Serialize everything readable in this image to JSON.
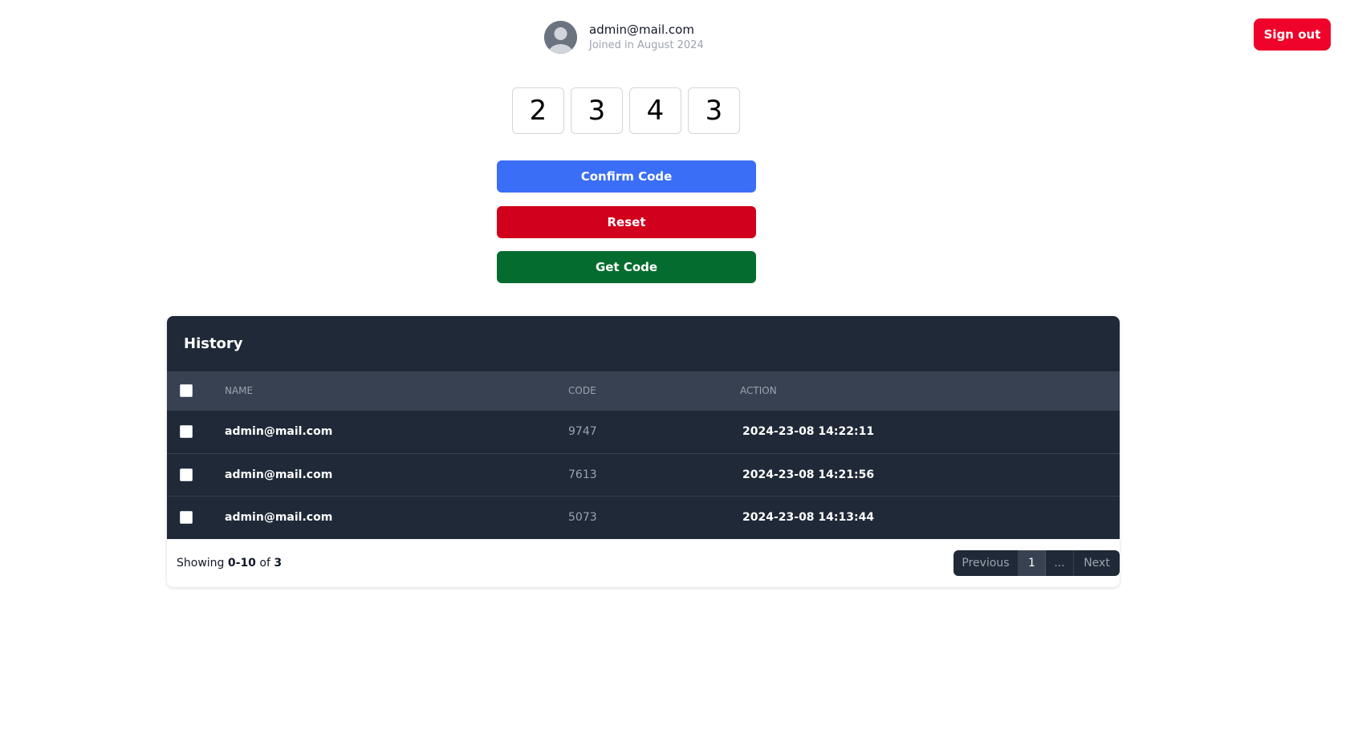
{
  "profile": {
    "email": "admin@mail.com",
    "joined": "Joined in August 2024",
    "avatar_icon": "user-avatar-icon"
  },
  "header": {
    "signout_label": "Sign out",
    "signout_color": "#f0032a"
  },
  "code": {
    "digits": [
      "2",
      "3",
      "4",
      "3"
    ]
  },
  "actions": {
    "confirm_label": "Confirm Code",
    "reset_label": "Reset",
    "get_label": "Get Code",
    "confirm_color": "#3b6ef6",
    "reset_color": "#d1001c",
    "get_color": "#046c2e"
  },
  "history": {
    "title": "History",
    "columns": [
      "NAME",
      "CODE",
      "ACTION"
    ],
    "rows": [
      {
        "name": "admin@mail.com",
        "code": "9747",
        "action": "2024-23-08 14:22:11"
      },
      {
        "name": "admin@mail.com",
        "code": "7613",
        "action": "2024-23-08 14:21:56"
      },
      {
        "name": "admin@mail.com",
        "code": "5073",
        "action": "2024-23-08 14:13:44"
      }
    ],
    "footer": {
      "showing_prefix": "Showing",
      "range": "0-10",
      "of_label": "of",
      "total": "3"
    },
    "pagination": {
      "previous_label": "Previous",
      "current_page": "1",
      "ellipsis": "...",
      "next_label": "Next"
    }
  }
}
